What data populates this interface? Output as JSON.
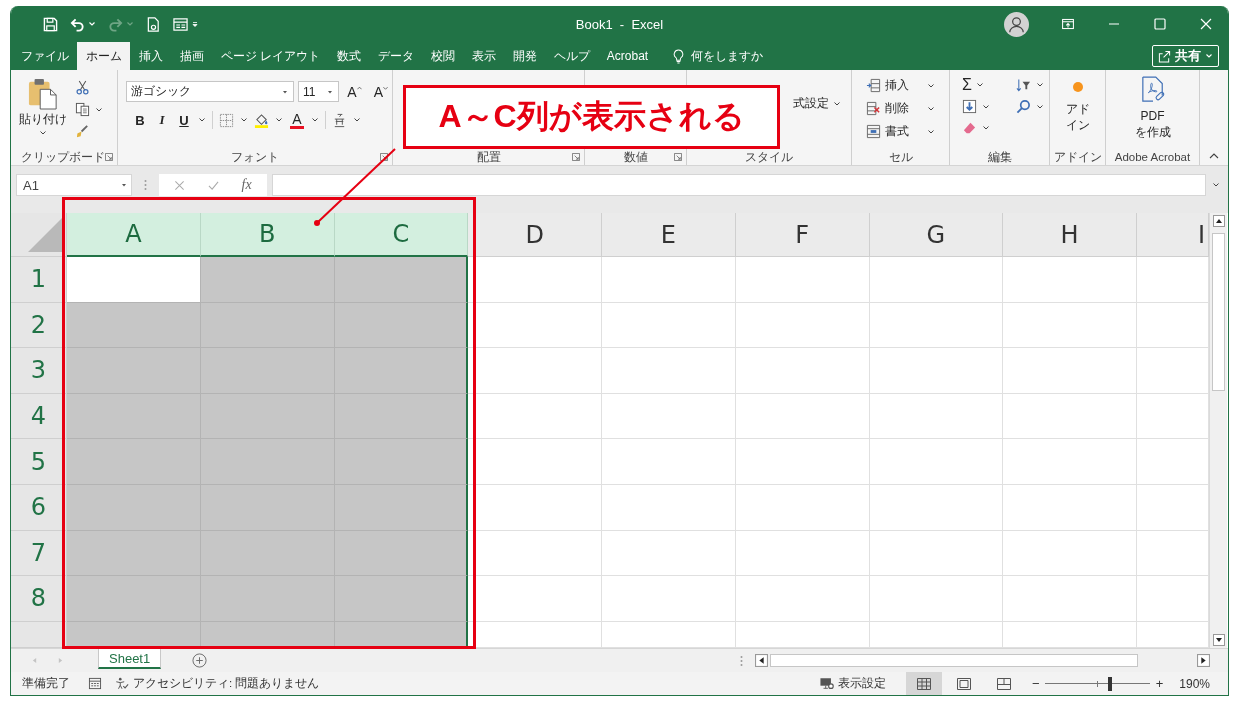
{
  "window": {
    "title": "Book1  -  Excel"
  },
  "quick_access": [
    {
      "kind": "save",
      "disabled": false
    },
    {
      "kind": "undo",
      "disabled": false
    },
    {
      "kind": "redo",
      "disabled": true
    },
    {
      "kind": "print_preview",
      "disabled": false
    },
    {
      "kind": "form",
      "disabled": false
    },
    {
      "kind": "customize",
      "disabled": false
    }
  ],
  "ribbon_tabs": [
    {
      "label": "ファイル",
      "selected": false
    },
    {
      "label": "ホーム",
      "selected": true
    },
    {
      "label": "挿入",
      "selected": false
    },
    {
      "label": "描画",
      "selected": false
    },
    {
      "label": "ページ レイアウト",
      "selected": false
    },
    {
      "label": "数式",
      "selected": false
    },
    {
      "label": "データ",
      "selected": false
    },
    {
      "label": "校閲",
      "selected": false
    },
    {
      "label": "表示",
      "selected": false
    },
    {
      "label": "開発",
      "selected": false
    },
    {
      "label": "ヘルプ",
      "selected": false
    },
    {
      "label": "Acrobat",
      "selected": false
    }
  ],
  "tell_me": {
    "label": "何をしますか"
  },
  "share_button": {
    "label": "共有"
  },
  "ribbon": {
    "clipboard": {
      "paste_label": "貼り付け",
      "group_label": "クリップボード"
    },
    "font": {
      "font_name": "游ゴシック",
      "font_size": "11",
      "grow_label": "A",
      "shrink_label": "A",
      "format_buttons": [
        {
          "kind": "bold",
          "label": "B"
        },
        {
          "kind": "italic",
          "label": "I"
        },
        {
          "kind": "underline",
          "label": "U"
        }
      ],
      "font_color_label": "A",
      "group_label": "フォント"
    },
    "alignment": {
      "group_label": "配置"
    },
    "number": {
      "group_label": "数値"
    },
    "styles": {
      "format_as_table_label": "式設定",
      "group_label": "スタイル"
    },
    "cells": {
      "items": [
        {
          "kind": "insert",
          "label": "挿入"
        },
        {
          "kind": "delete",
          "label": "削除"
        },
        {
          "kind": "format",
          "label": "書式"
        }
      ],
      "group_label": "セル"
    },
    "editing": {
      "autosum_label": "Σ",
      "group_label": "編集"
    },
    "addins": {
      "button_label": "アドイン",
      "group_label": "アドイン"
    },
    "acrobat": {
      "button_label": "PDF\nを作成",
      "group_label": "Adobe Acrobat"
    }
  },
  "name_box": {
    "value": "A1"
  },
  "formula_bar": {
    "fx_label": "fx"
  },
  "columns": [
    {
      "label": "A",
      "selected": true,
      "active": true
    },
    {
      "label": "B",
      "selected": true,
      "active": false
    },
    {
      "label": "C",
      "selected": true,
      "active": false
    },
    {
      "label": "D",
      "selected": false,
      "active": false
    },
    {
      "label": "E",
      "selected": false,
      "active": false
    },
    {
      "label": "F",
      "selected": false,
      "active": false
    },
    {
      "label": "G",
      "selected": false,
      "active": false
    },
    {
      "label": "H",
      "selected": false,
      "active": false
    },
    {
      "label": "I",
      "selected": false,
      "active": false
    }
  ],
  "rows": [
    {
      "label": "1",
      "selected": true,
      "active": true
    },
    {
      "label": "2",
      "selected": true,
      "active": false
    },
    {
      "label": "3",
      "selected": true,
      "active": false
    },
    {
      "label": "4",
      "selected": true,
      "active": false
    },
    {
      "label": "5",
      "selected": true,
      "active": false
    },
    {
      "label": "6",
      "selected": true,
      "active": false
    },
    {
      "label": "7",
      "selected": true,
      "active": false
    },
    {
      "label": "8",
      "selected": true,
      "active": false
    }
  ],
  "annotation": {
    "label": "A～C列が表示される"
  },
  "sheet_tabs": [
    {
      "label": "Sheet1",
      "selected": true
    }
  ],
  "status_bar": {
    "mode": "準備完了",
    "accessibility": "アクセシビリティ: 問題ありません",
    "display_settings": "表示設定",
    "views": [
      {
        "kind": "normal",
        "selected": true
      },
      {
        "kind": "page_layout",
        "selected": false
      },
      {
        "kind": "page_break_preview",
        "selected": false
      }
    ],
    "zoom": {
      "minus": "−",
      "plus": "+",
      "level": 0.62,
      "reading": "190%"
    }
  }
}
